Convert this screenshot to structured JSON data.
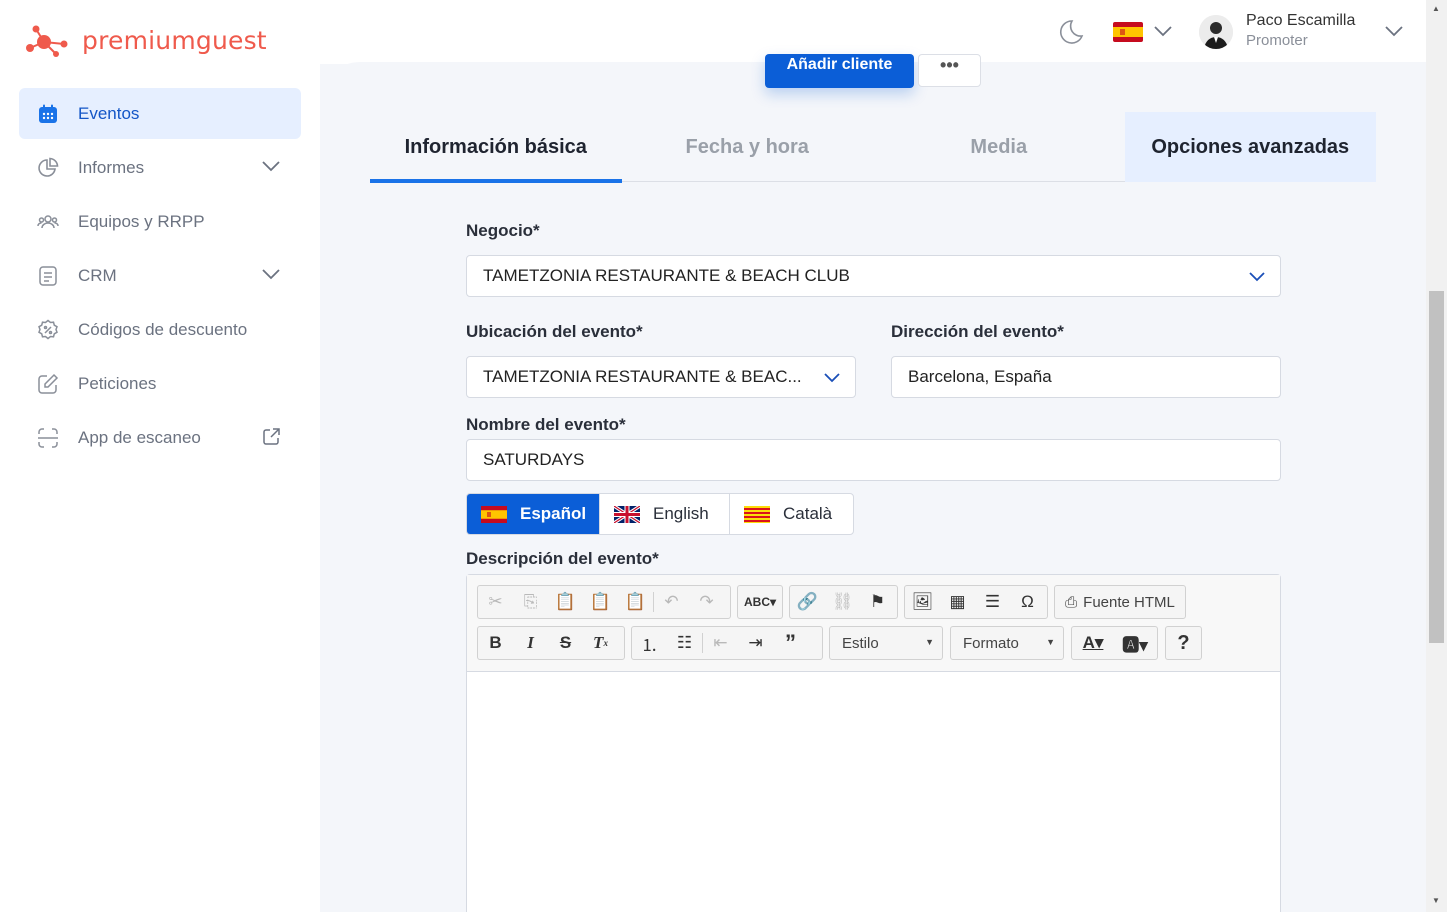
{
  "brand": {
    "name": "premiumguest",
    "color": "#ef5a4c"
  },
  "sidebar": {
    "items": [
      {
        "label": "Eventos",
        "icon": "calendar-icon",
        "active": true
      },
      {
        "label": "Informes",
        "icon": "pie-chart-icon",
        "expandable": true
      },
      {
        "label": "Equipos y RRPP",
        "icon": "users-icon"
      },
      {
        "label": "CRM",
        "icon": "document-icon",
        "expandable": true
      },
      {
        "label": "Códigos de descuento",
        "icon": "discount-badge-icon"
      },
      {
        "label": "Peticiones",
        "icon": "edit-icon"
      },
      {
        "label": "App de escaneo",
        "icon": "scan-icon",
        "external": true
      }
    ]
  },
  "header": {
    "user": {
      "name": "Paco Escamilla",
      "role": "Promoter"
    },
    "language": "es"
  },
  "actions": {
    "add_client": "Añadir cliente",
    "more": "•••"
  },
  "tabs": [
    {
      "label": "Información básica",
      "active": true
    },
    {
      "label": "Fecha y hora"
    },
    {
      "label": "Media"
    },
    {
      "label": "Opciones avanzadas"
    }
  ],
  "form": {
    "negocio": {
      "label": "Negocio*",
      "value": "TAMETZONIA RESTAURANTE & BEACH CLUB"
    },
    "ubicacion": {
      "label": "Ubicación del evento*",
      "value": "TAMETZONIA RESTAURANTE & BEAC..."
    },
    "direccion": {
      "label": "Dirección del evento*",
      "value": "Barcelona, España"
    },
    "nombre": {
      "label": "Nombre del evento*",
      "value": "SATURDAYS"
    },
    "languages": [
      {
        "label": "Español",
        "active": true
      },
      {
        "label": "English"
      },
      {
        "label": "Català"
      }
    ],
    "descripcion": {
      "label": "Descripción del evento*"
    }
  },
  "editor": {
    "source_label": "Fuente HTML",
    "style_label": "Estilo",
    "format_label": "Formato"
  },
  "colors": {
    "primary": "#0b5ed7",
    "accent": "#1a73e8",
    "active_bg": "#e6efff"
  }
}
